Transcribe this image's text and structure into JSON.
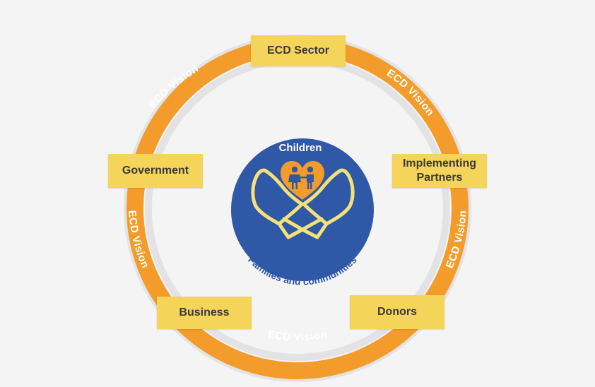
{
  "diagram": {
    "center": {
      "title": "Children",
      "caption": "Families and communities"
    },
    "ring": {
      "segment_label": "ECD Vision",
      "segment_labels": [
        "ECD Vision",
        "ECD Vision",
        "ECD Vision",
        "ECD Vision",
        "ECD Vision"
      ]
    },
    "stakeholders": {
      "ecd_sector": "ECD Sector",
      "government": "Government",
      "implementing_line1": "Implementing",
      "implementing_line2": "Partners",
      "business": "Business",
      "donors": "Donors"
    },
    "icons": {
      "center": "caring-hands-icon",
      "heart": "heart-icon",
      "children": "children-icon"
    },
    "colors": {
      "ring_orange": "#f39c2b",
      "ring_grey": "#e3e3e5",
      "center_blue": "#2f58a6",
      "box_yellow": "#f5d45a",
      "hands_yellow": "#f3e27a",
      "heart_orange": "#f39c2b",
      "figure_blue": "#2f58a6",
      "caption_blue": "#2f58a6"
    }
  }
}
